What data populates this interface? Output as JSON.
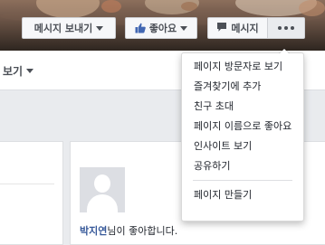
{
  "header": {
    "send_message_label": "메시지 보내기",
    "like_label": "좋아요",
    "message_label": "메시지"
  },
  "tabs": {
    "more_label": "보기"
  },
  "menu": {
    "items": [
      "페이지 방문자로 보기",
      "즐겨찾기에 추가",
      "친구 초대",
      "페이지 이름으로 좋아요",
      "인사이트 보기",
      "공유하기"
    ],
    "create_page_label": "페이지 만들기"
  },
  "likes": {
    "name": "박지연",
    "suffix": "님이 좋아합니다."
  },
  "colors": {
    "link_blue": "#365899",
    "like_blue": "#4267b2"
  },
  "icons": [
    "thumbs-up-icon",
    "speech-bubble-icon",
    "more-dots-icon",
    "caret-down-icon",
    "default-avatar-icon"
  ]
}
